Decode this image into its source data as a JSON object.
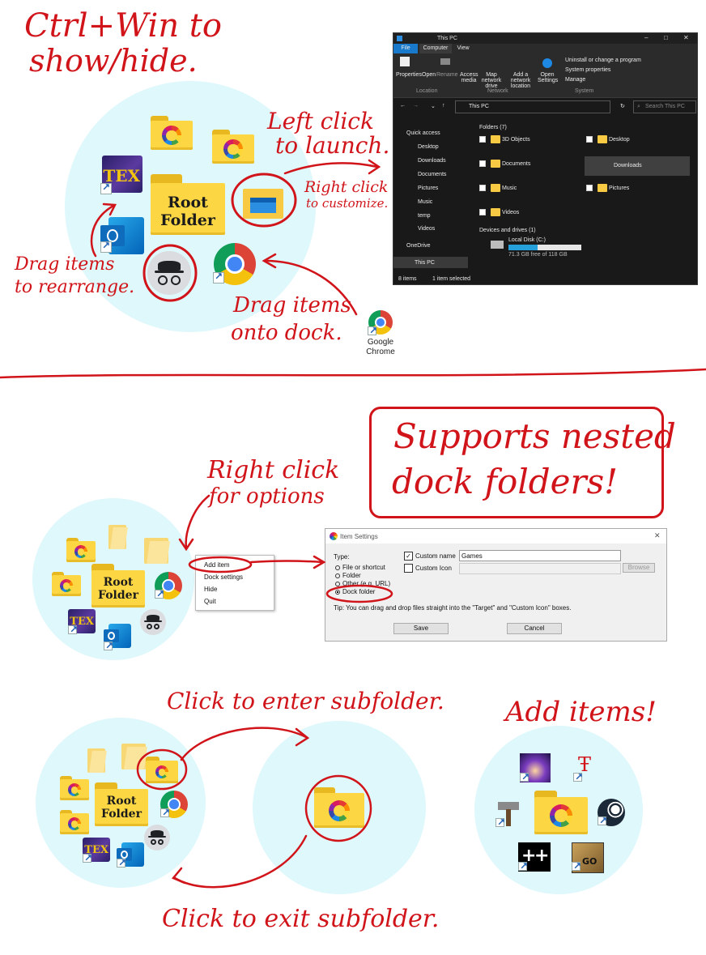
{
  "annotations": {
    "ctrl_win": "Ctrl+Win to",
    "show_hide": "show/hide.",
    "left_click": "Left click",
    "to_launch": "to launch.",
    "right_click": "Right click",
    "to_customize": "to customize.",
    "drag_items": "Drag items",
    "to_rearrange": "to rearrange.",
    "drag_items2": "Drag items",
    "onto_dock": "onto dock.",
    "supports": "Supports nested",
    "dock_folders": "dock folders!",
    "right_click2": "Right click",
    "for_options": "for options",
    "click_enter": "Click to enter subfolder.",
    "click_exit": "Click to exit subfolder.",
    "add_items": "Add items!"
  },
  "dock": {
    "root_line1": "Root",
    "root_line2": "Folder",
    "desktop_icon_label": "Google Chrome"
  },
  "explorer": {
    "title": "This PC",
    "menu": [
      "File",
      "Computer",
      "View"
    ],
    "ribbon": {
      "properties": "Properties",
      "open": "Open",
      "rename": "Rename",
      "access_media": "Access media",
      "map_drive": "Map network drive",
      "add_location": "Add a network location",
      "open_settings": "Open Settings",
      "uninstall": "Uninstall or change a program",
      "system_properties": "System properties",
      "manage": "Manage",
      "group_location": "Location",
      "group_network": "Network",
      "group_system": "System"
    },
    "address": "This PC",
    "search_placeholder": "Search This PC",
    "nav": [
      "Quick access",
      "Desktop",
      "Downloads",
      "Documents",
      "Pictures",
      "Music",
      "temp",
      "Videos",
      "OneDrive",
      "This PC"
    ],
    "folders_header": "Folders (7)",
    "folders": [
      "3D Objects",
      "Desktop",
      "Documents",
      "Downloads",
      "Music",
      "Pictures",
      "Videos"
    ],
    "devices_header": "Devices and drives (1)",
    "drive_name": "Local Disk (C:)",
    "drive_free": "71.3 GB free of 118 GB",
    "drive_used_fraction": 0.4,
    "status_items": "8 items",
    "status_selected": "1 item selected"
  },
  "context_menu": {
    "items": [
      "Add item",
      "Dock settings",
      "Hide",
      "Quit"
    ]
  },
  "settings": {
    "title": "Item Settings",
    "type_label": "Type:",
    "options": [
      "File or shortcut",
      "Folder",
      "Other (e.g. URL)",
      "Dock folder"
    ],
    "selected_option": "Dock folder",
    "custom_name_label": "Custom name",
    "custom_name_value": "Games",
    "custom_icon_label": "Custom Icon",
    "browse": "Browse",
    "tip": "Tip: You can drag and drop files straight into the \"Target\" and \"Custom Icon\" boxes.",
    "save": "Save",
    "cancel": "Cancel"
  }
}
